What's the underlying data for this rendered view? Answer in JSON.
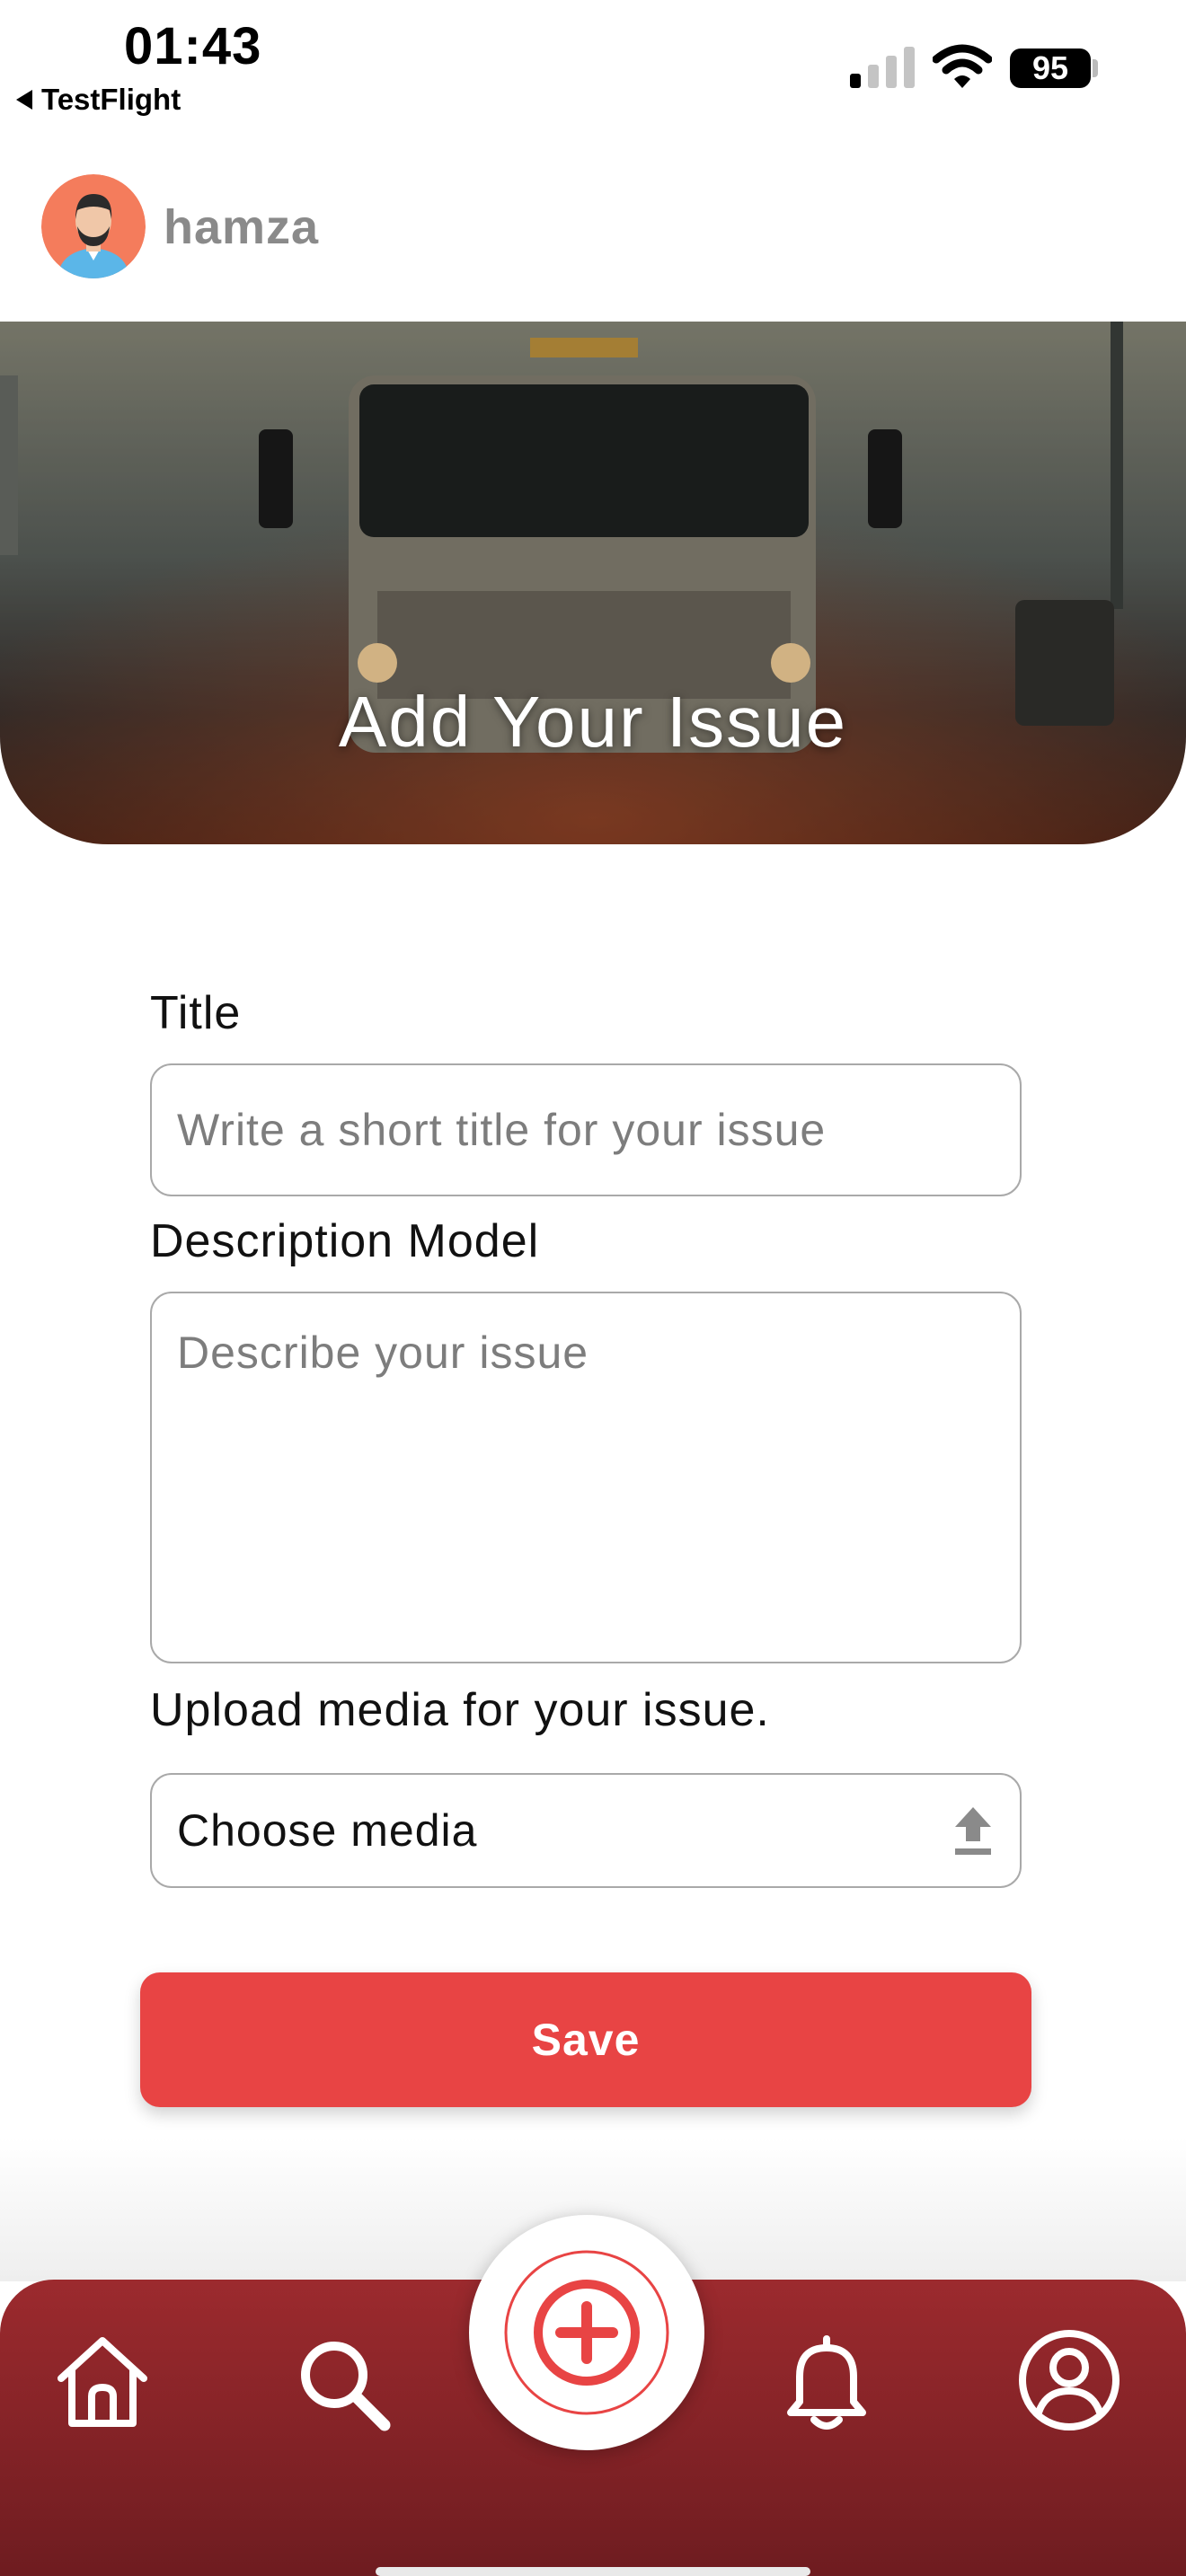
{
  "status_bar": {
    "time": "01:43",
    "back_app": "TestFlight",
    "battery": "95"
  },
  "header": {
    "username": "hamza"
  },
  "hero": {
    "title": "Add Your Issue"
  },
  "form": {
    "title_label": "Title",
    "title_placeholder": "Write a short title for your issue",
    "description_label": "Description Model",
    "description_placeholder": "Describe your issue",
    "media_label": "Upload media for your issue.",
    "media_button": "Choose media",
    "save_label": "Save"
  },
  "nav": {
    "items": [
      "home-icon",
      "search-icon",
      "add-icon",
      "bell-icon",
      "profile-icon"
    ],
    "accent": "#e84444",
    "bar_color": "#8b2428"
  }
}
